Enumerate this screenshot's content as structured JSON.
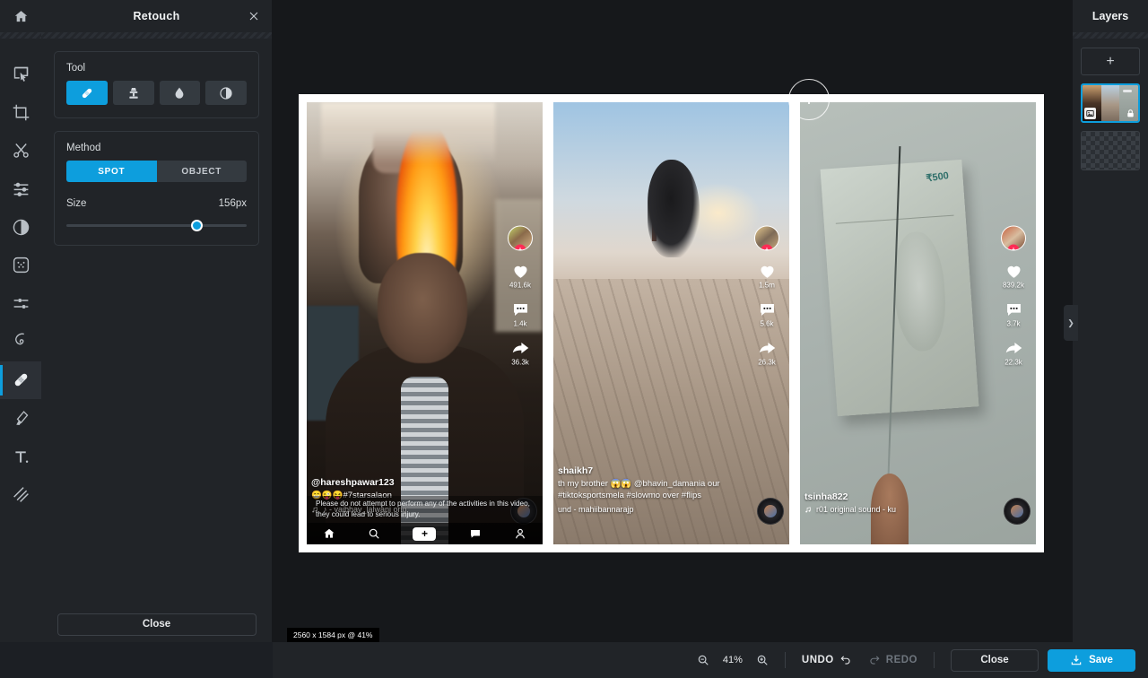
{
  "rail": {
    "home_icon": "home-icon",
    "items": [
      {
        "name": "select",
        "icon": "cursor-select-icon"
      },
      {
        "name": "crop",
        "icon": "crop-icon"
      },
      {
        "name": "cut",
        "icon": "scissors-icon"
      },
      {
        "name": "adjust",
        "icon": "sliders-icon"
      },
      {
        "name": "contrast",
        "icon": "contrast-icon"
      },
      {
        "name": "effects",
        "icon": "effects-grid-icon"
      },
      {
        "name": "curves",
        "icon": "nodes-icon"
      },
      {
        "name": "liquify",
        "icon": "spiral-icon"
      },
      {
        "name": "retouch",
        "icon": "bandage-icon"
      },
      {
        "name": "paint",
        "icon": "brush-icon"
      },
      {
        "name": "text",
        "icon": "text-t-icon"
      },
      {
        "name": "texture",
        "icon": "hatch-lines-icon"
      }
    ],
    "active_index": 8
  },
  "panel": {
    "title": "Retouch",
    "close_icon": "close-icon",
    "tool": {
      "label": "Tool",
      "options": [
        {
          "name": "bandage",
          "icon": "bandage-icon"
        },
        {
          "name": "clone-stamp",
          "icon": "stamp-icon"
        },
        {
          "name": "blur-drop",
          "icon": "droplet-icon"
        },
        {
          "name": "dodge-burn",
          "icon": "half-circle-icon"
        }
      ],
      "selected_index": 0
    },
    "method": {
      "label": "Method",
      "options": [
        "SPOT",
        "OBJECT"
      ],
      "selected": "SPOT"
    },
    "size": {
      "label": "Size",
      "value": "156px",
      "percent": 72
    },
    "close_label": "Close"
  },
  "canvas": {
    "status": "2560 x 1584 px @ 41%",
    "brush_cursor": "brush-cursor-circle",
    "videos": [
      {
        "username": "@hareshpawar123",
        "caption": "😁😜😝#7starsalaon",
        "music": "♪ - vaibhav_lalwani   orig",
        "warning": "Please do not attempt to perform any of the activities in this video, they could lead to serious injury.",
        "likes": "491.6k",
        "comments": "1.4k",
        "shares": "36.3k",
        "nav": [
          {
            "name": "home",
            "icon": "home-icon",
            "label": ""
          },
          {
            "name": "discover",
            "icon": "search-icon",
            "label": ""
          },
          {
            "name": "create",
            "icon": "plus-icon",
            "label": "+"
          },
          {
            "name": "inbox",
            "icon": "message-icon",
            "label": ""
          },
          {
            "name": "profile",
            "icon": "person-icon",
            "label": ""
          }
        ]
      },
      {
        "username": "shaikh7",
        "caption": "th my brother 😱😱 @bhavin_damania our #tiktoksportsmela #slowmo over #flips",
        "music": "und - mahiibannarajp",
        "likes": "1.5m",
        "comments": "5.6k",
        "shares": "26.3k"
      },
      {
        "username": "tsinha822",
        "caption": "",
        "music": "r01   original sound - ku",
        "likes": "839.2k",
        "comments": "3.7k",
        "shares": "22.3k"
      }
    ]
  },
  "layers": {
    "title": "Layers",
    "add_label": "+",
    "items": [
      {
        "name": "image-layer",
        "selected": true,
        "locked": true
      },
      {
        "name": "empty-layer",
        "selected": false,
        "locked": false
      }
    ]
  },
  "bottombar": {
    "zoom_out_icon": "zoom-out-icon",
    "zoom_value": "41%",
    "zoom_in_icon": "zoom-in-icon",
    "undo_label": "UNDO",
    "redo_label": "REDO",
    "close_label": "Close",
    "save_label": "Save"
  },
  "handle": {
    "icon": "chevron-right-icon",
    "glyph": "❯"
  },
  "colors": {
    "accent": "#0d9edd",
    "panel_bg": "#212428",
    "stage_bg": "#16181b",
    "tiktok_pink": "#fe2c55",
    "tiktok_cyan": "#25f4ee"
  }
}
